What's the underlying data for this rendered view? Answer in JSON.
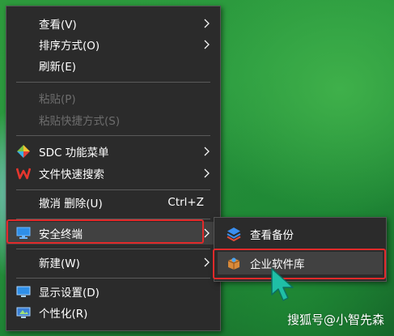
{
  "context_menu": {
    "items": [
      {
        "label": "查看(V)",
        "has_submenu": true,
        "disabled": false
      },
      {
        "label": "排序方式(O)",
        "has_submenu": true,
        "disabled": false
      },
      {
        "label": "刷新(E)",
        "has_submenu": false,
        "disabled": false
      },
      {
        "label": "粘贴(P)",
        "has_submenu": false,
        "disabled": true
      },
      {
        "label": "粘贴快捷方式(S)",
        "has_submenu": false,
        "disabled": true
      },
      {
        "label": "SDC 功能菜单",
        "icon": "sdc-diamond-icon",
        "has_submenu": true,
        "disabled": false
      },
      {
        "label": "文件快速搜索",
        "icon": "wps-w-icon",
        "has_submenu": true,
        "disabled": false
      },
      {
        "label": "撤消 删除(U)",
        "shortcut": "Ctrl+Z",
        "has_submenu": false,
        "disabled": false
      },
      {
        "label": "安全终端",
        "icon": "monitor-icon",
        "has_submenu": true,
        "highlighted": true,
        "disabled": false
      },
      {
        "label": "新建(W)",
        "has_submenu": true,
        "disabled": false
      },
      {
        "label": "显示设置(D)",
        "icon": "display-icon",
        "has_submenu": false,
        "disabled": false
      },
      {
        "label": "个性化(R)",
        "icon": "personalize-icon",
        "has_submenu": false,
        "disabled": false
      }
    ]
  },
  "submenu": {
    "items": [
      {
        "label": "查看备份",
        "icon": "layers-icon"
      },
      {
        "label": "企业软件库",
        "icon": "software-box-icon",
        "highlighted": true
      }
    ]
  },
  "watermark": {
    "text": "搜狐号@小智先森"
  },
  "colors": {
    "menu_bg": "#2b2b2b",
    "highlight_bg": "#414141",
    "annotation_red": "#e12a2a",
    "disabled_text": "#6d6d6d",
    "cursor_teal": "#1fbfa6"
  }
}
